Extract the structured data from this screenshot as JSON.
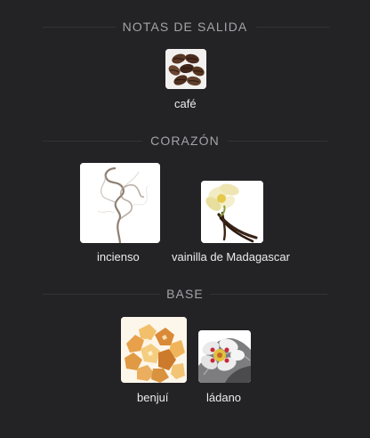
{
  "sections": [
    {
      "title": "NOTAS DE SALIDA",
      "notes": [
        {
          "label": "café",
          "icon": "coffee-beans-icon"
        }
      ]
    },
    {
      "title": "CORAZÓN",
      "notes": [
        {
          "label": "incienso",
          "icon": "incense-smoke-icon"
        },
        {
          "label": "vainilla de Madagascar",
          "icon": "vanilla-flower-icon"
        }
      ]
    },
    {
      "title": "BASE",
      "notes": [
        {
          "label": "benjuí",
          "icon": "benzoin-resin-icon"
        },
        {
          "label": "ládano",
          "icon": "labdanum-flower-icon"
        }
      ]
    }
  ]
}
